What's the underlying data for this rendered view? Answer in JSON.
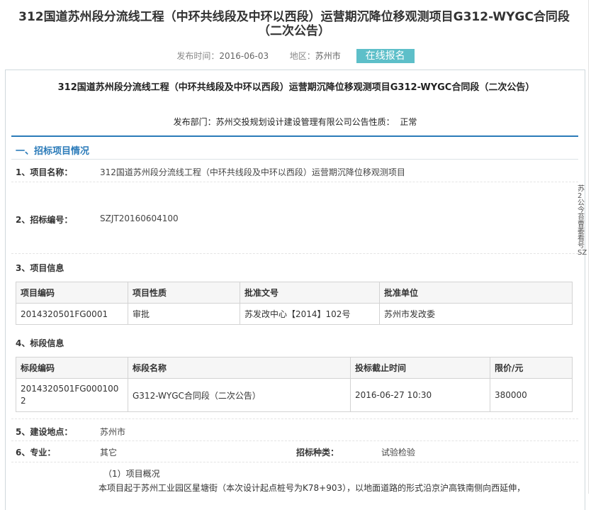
{
  "header": {
    "title": "312国道苏州段分流线工程（中环共线段及中环以西段）运营期沉降位移观测项目G312-WYGC合同段（二次公告）",
    "publish_time_label": "发布时间：",
    "publish_time": "2016-06-03",
    "region_label": "地区：",
    "region": "苏州市",
    "signup_button": "在线报名"
  },
  "doc": {
    "title": "312国道苏州段分流线工程（中环共线段及中环以西段）运营期沉降位移观测项目G312-WYGC合同段（二次公告）",
    "dept_label": "发布部门：",
    "dept": "苏州交投规划设计建设管理有限公司",
    "nature_label": "公告性质：",
    "nature": "正常",
    "section1_heading": "一、招标项目情况",
    "project_name_label": "1、项目名称：",
    "project_name": "312国道苏州段分流线工程（中环共线段及中环以西段）运营期沉降位移观测项目",
    "bid_no_label": "2、招标编号：",
    "bid_no": "SZJT20160604100",
    "project_info_label": "3、项目信息",
    "project_table": {
      "headers": [
        "项目编码",
        "项目性质",
        "批准文号",
        "批准单位"
      ],
      "rows": [
        [
          "2014320501FG0001",
          "审批",
          "苏发改中心【2014】102号",
          "苏州市发改委"
        ]
      ]
    },
    "lot_info_label": "4、标段信息",
    "lot_table": {
      "headers": [
        "标段编码",
        "标段名称",
        "投标截止时间",
        "限价/元"
      ],
      "rows": [
        [
          "2014320501FG0001002",
          "G312-WYGC合同段（二次公告）",
          "2016-06-27 10:30",
          "380000"
        ]
      ]
    },
    "site_label": "5、建设地点：",
    "site": "苏州市",
    "major_label": "6、专业：",
    "major": "其它",
    "bid_type_label": "招标种类：",
    "bid_type": "试验检验",
    "overview_heading": "（1）项目概况",
    "overview_text": "本项目起于苏州工业园区星塘街（本次设计起点桩号为K78+903），以地面道路的形式沿京沪高铁南侧向西延伸，"
  },
  "side": {
    "text": "苏2公今苔曹萎看号SZ"
  },
  "colors": {
    "accent_blue": "#2b7bb9",
    "button_teal": "#5dbfc9"
  }
}
